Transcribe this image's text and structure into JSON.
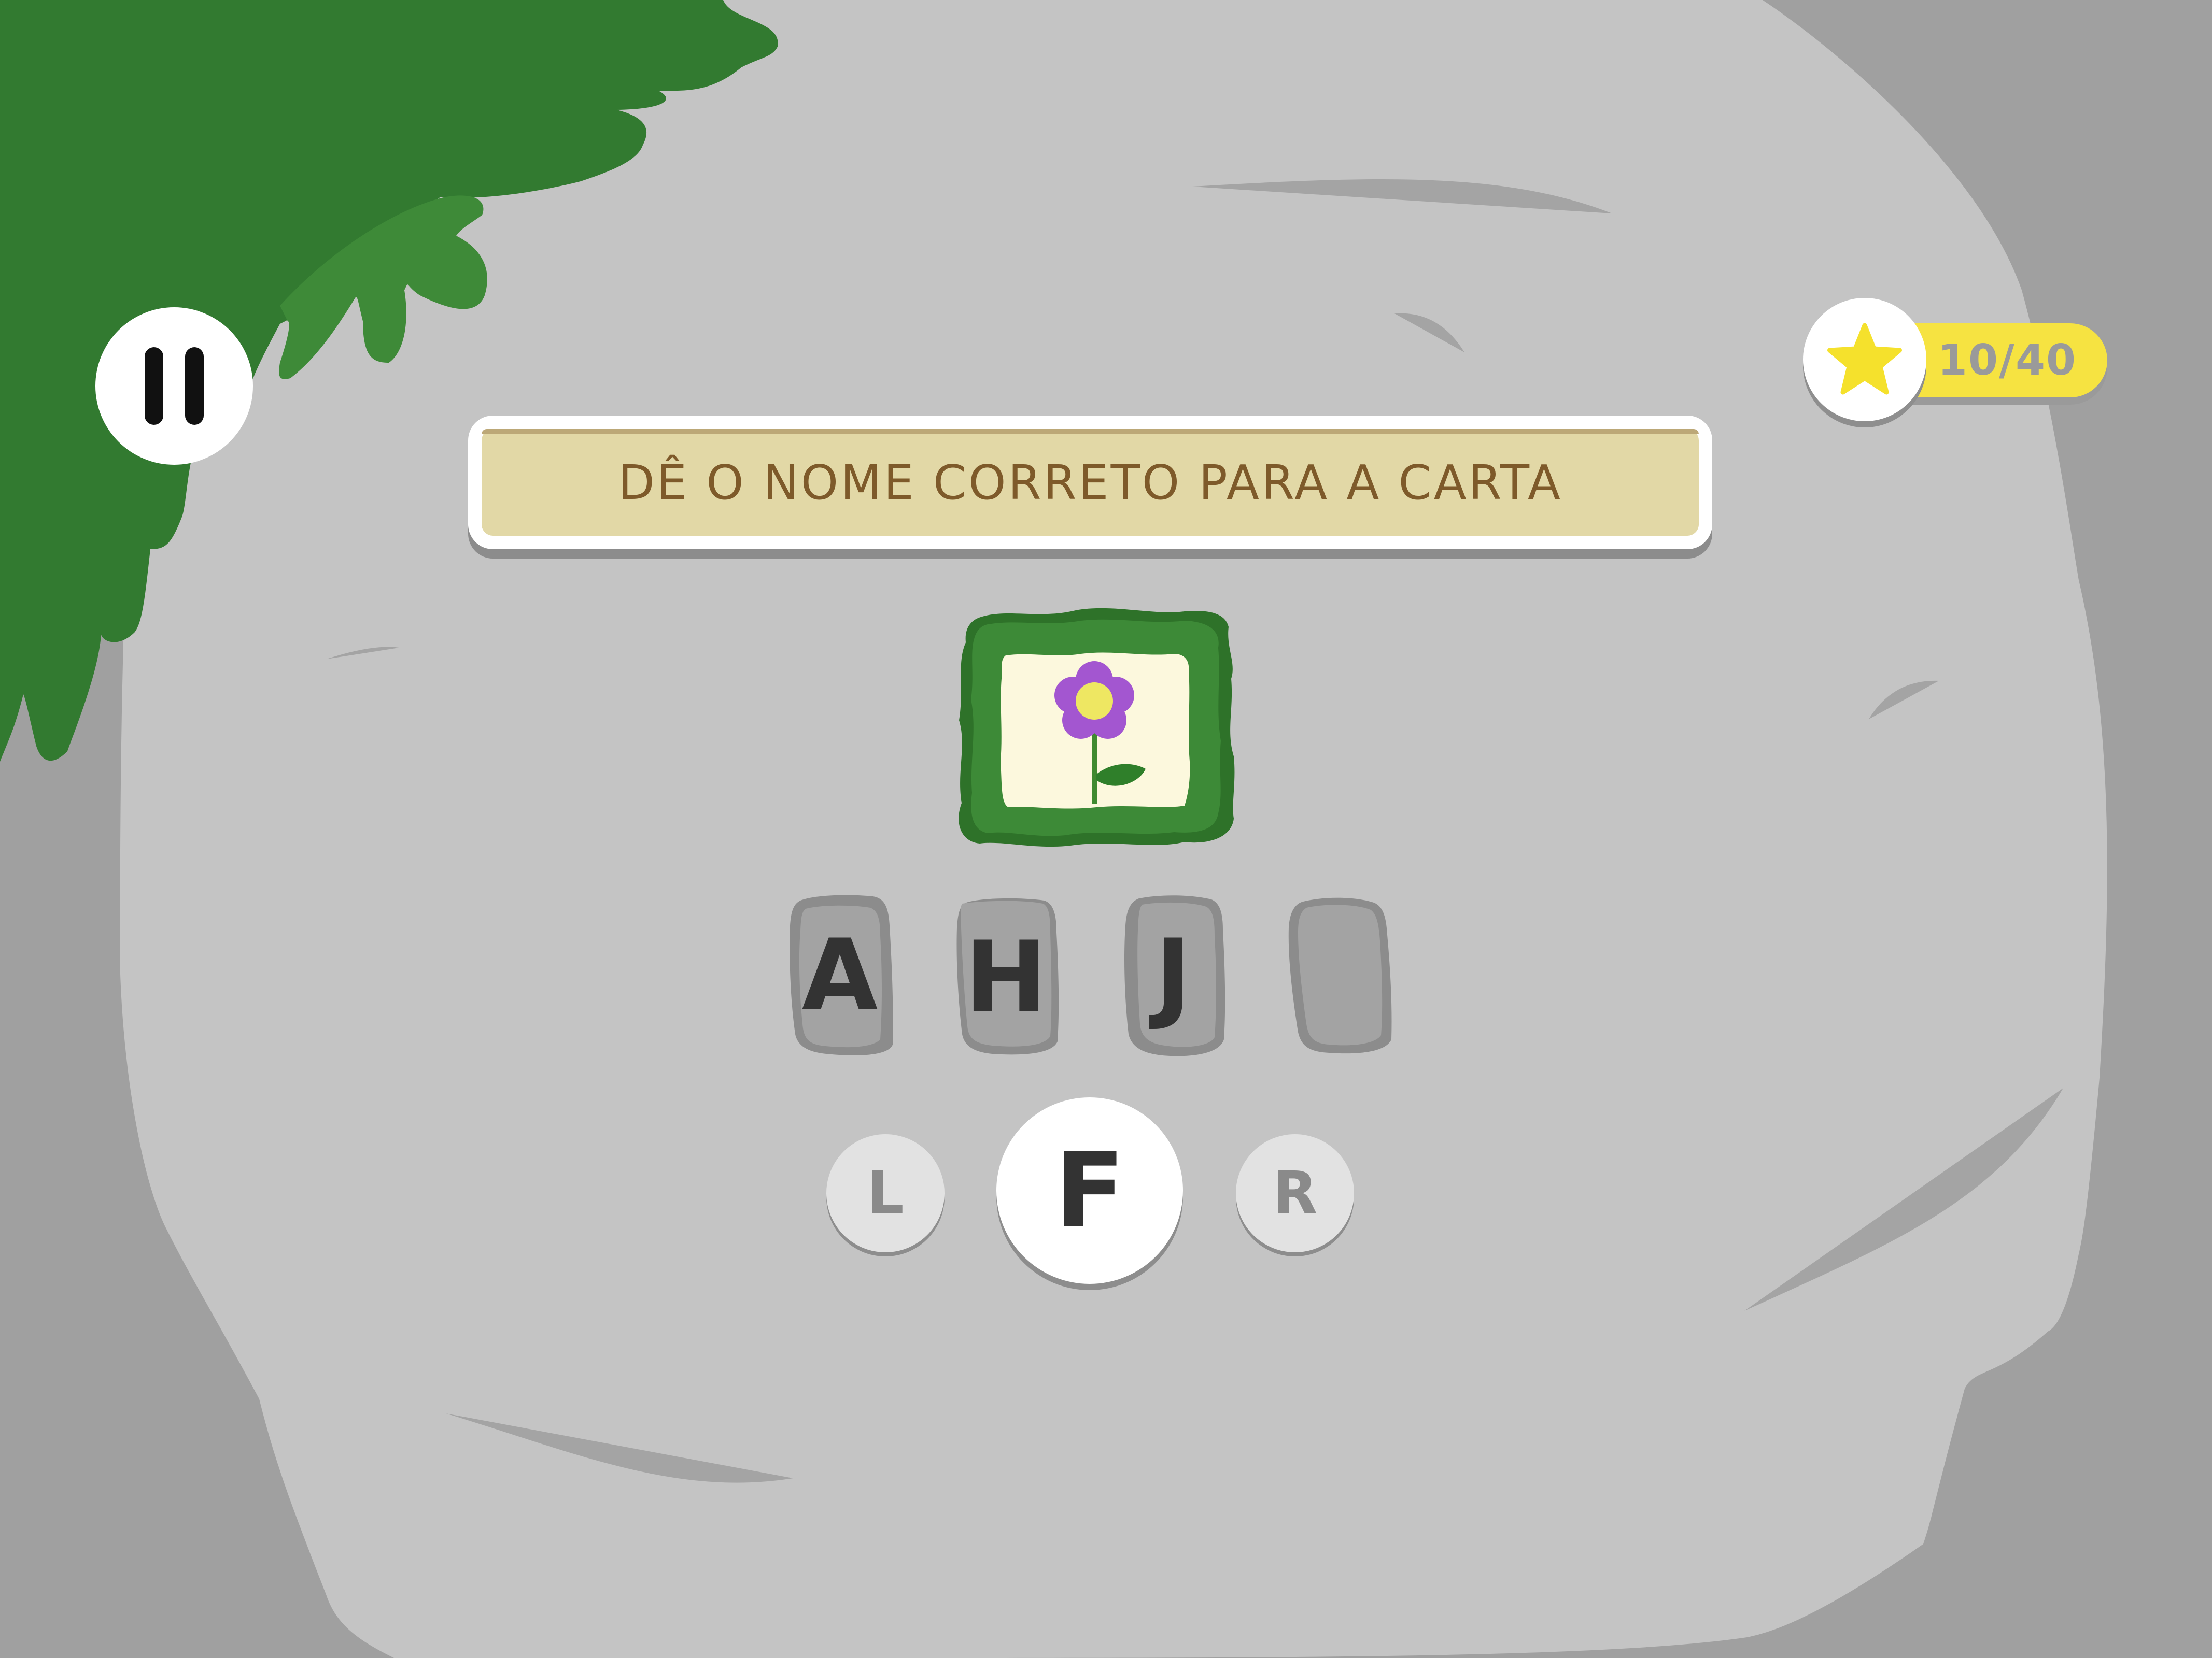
{
  "hud": {
    "pause_icon": "pause-icon",
    "score_icon": "star-icon",
    "score_text": "10/40"
  },
  "prompt": {
    "text": "DÊ O NOME CORRETO PARA A CARTA"
  },
  "card": {
    "icon": "flower-icon"
  },
  "answer_slots": [
    {
      "letter": "A"
    },
    {
      "letter": "H"
    },
    {
      "letter": "J"
    },
    {
      "letter": ""
    }
  ],
  "choices": [
    {
      "letter": "L"
    },
    {
      "letter": "F"
    },
    {
      "letter": "R"
    }
  ],
  "colors": {
    "background": "#a0a0a0",
    "rock": "#c4c4c4",
    "rock_shadow": "#a4a4a4",
    "foliage": "#327a30",
    "foliage_light": "#3e8a38",
    "banner": "#e2d8a6",
    "banner_text": "#7e5a2a",
    "score_pill": "#f6e341",
    "star": "#f5e12c",
    "flower_petal": "#a356d0",
    "flower_center": "#eee762"
  }
}
